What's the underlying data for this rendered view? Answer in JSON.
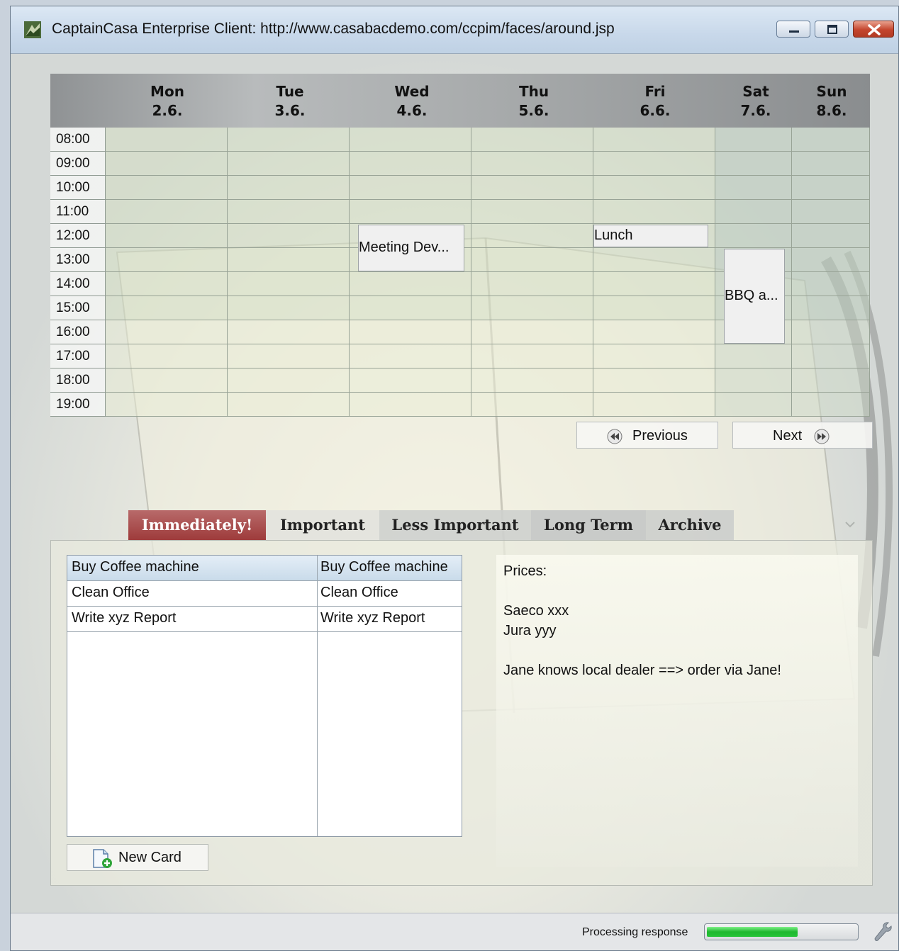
{
  "window": {
    "title": "CaptainCasa Enterprise Client: http://www.casabacdemo.com/ccpim/faces/around.jsp"
  },
  "calendar": {
    "days": [
      {
        "name": "Mon",
        "date": "2.6."
      },
      {
        "name": "Tue",
        "date": "3.6."
      },
      {
        "name": "Wed",
        "date": "4.6."
      },
      {
        "name": "Thu",
        "date": "5.6."
      },
      {
        "name": "Fri",
        "date": "6.6."
      },
      {
        "name": "Sat",
        "date": "7.6."
      },
      {
        "name": "Sun",
        "date": "8.6."
      }
    ],
    "times": [
      "08:00",
      "09:00",
      "10:00",
      "11:00",
      "12:00",
      "13:00",
      "14:00",
      "15:00",
      "16:00",
      "17:00",
      "18:00",
      "19:00"
    ],
    "appointments": [
      {
        "label": "Meeting Dev...",
        "day": 2,
        "start": 4,
        "span": 2
      },
      {
        "label": "Lunch",
        "day": 4,
        "start": 4,
        "span": 1
      },
      {
        "label": "BBQ a...",
        "day": 5,
        "start": 5,
        "span": 4
      }
    ],
    "previous_label": "Previous",
    "next_label": "Next"
  },
  "tabs": [
    {
      "label": "Immediately!",
      "active": true
    },
    {
      "label": "Important",
      "active": false
    },
    {
      "label": "Less Important",
      "active": false
    },
    {
      "label": "Long Term",
      "active": false
    },
    {
      "label": "Archive",
      "active": false
    }
  ],
  "tasks": {
    "rows": [
      {
        "title": "Buy Coffee machine",
        "preview": "Buy Coffee machine",
        "selected": true
      },
      {
        "title": "Clean Office",
        "preview": "Clean Office",
        "selected": false
      },
      {
        "title": "Write xyz Report",
        "preview": "Write xyz Report",
        "selected": false
      }
    ],
    "new_card_label": "New Card"
  },
  "notes": {
    "lines": [
      "Prices:",
      "",
      "Saeco xxx",
      "Jura yyy",
      "",
      "Jane knows local dealer ==> order via Jane!"
    ]
  },
  "status": {
    "text": "Processing response",
    "progress": 0.62
  },
  "colors": {
    "active_tab": "#9e3b3b",
    "progress_fill": "#25c437"
  }
}
